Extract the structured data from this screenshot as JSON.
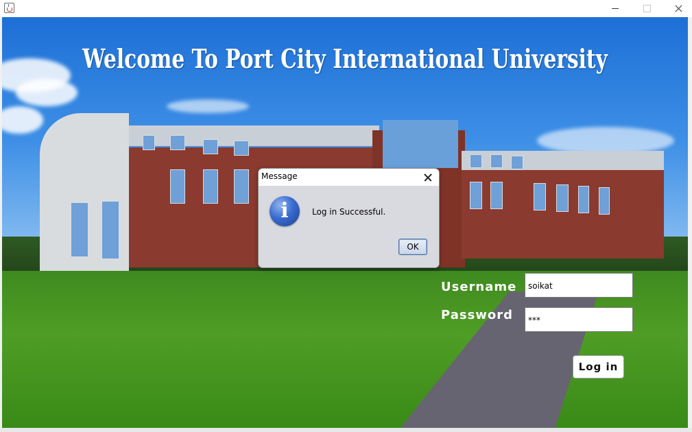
{
  "window": {
    "icon": "java-cup-icon",
    "controls": [
      "minimize-icon",
      "maximize-icon",
      "close-icon"
    ]
  },
  "main": {
    "title": "Welcome To Port City International University",
    "username_label": "Username",
    "password_label": "Password",
    "username_value": "soikat",
    "password_value": "***",
    "login_label": "Log in"
  },
  "dialog": {
    "title": "Message",
    "icon": "info-icon",
    "message": "Log in Successful.",
    "ok_label": "OK"
  },
  "colors": {
    "sky": "#1d6fd6",
    "grass": "#4f9d25",
    "dialog_body": "#d9d9e0",
    "info_icon": "#3a6ccf"
  }
}
